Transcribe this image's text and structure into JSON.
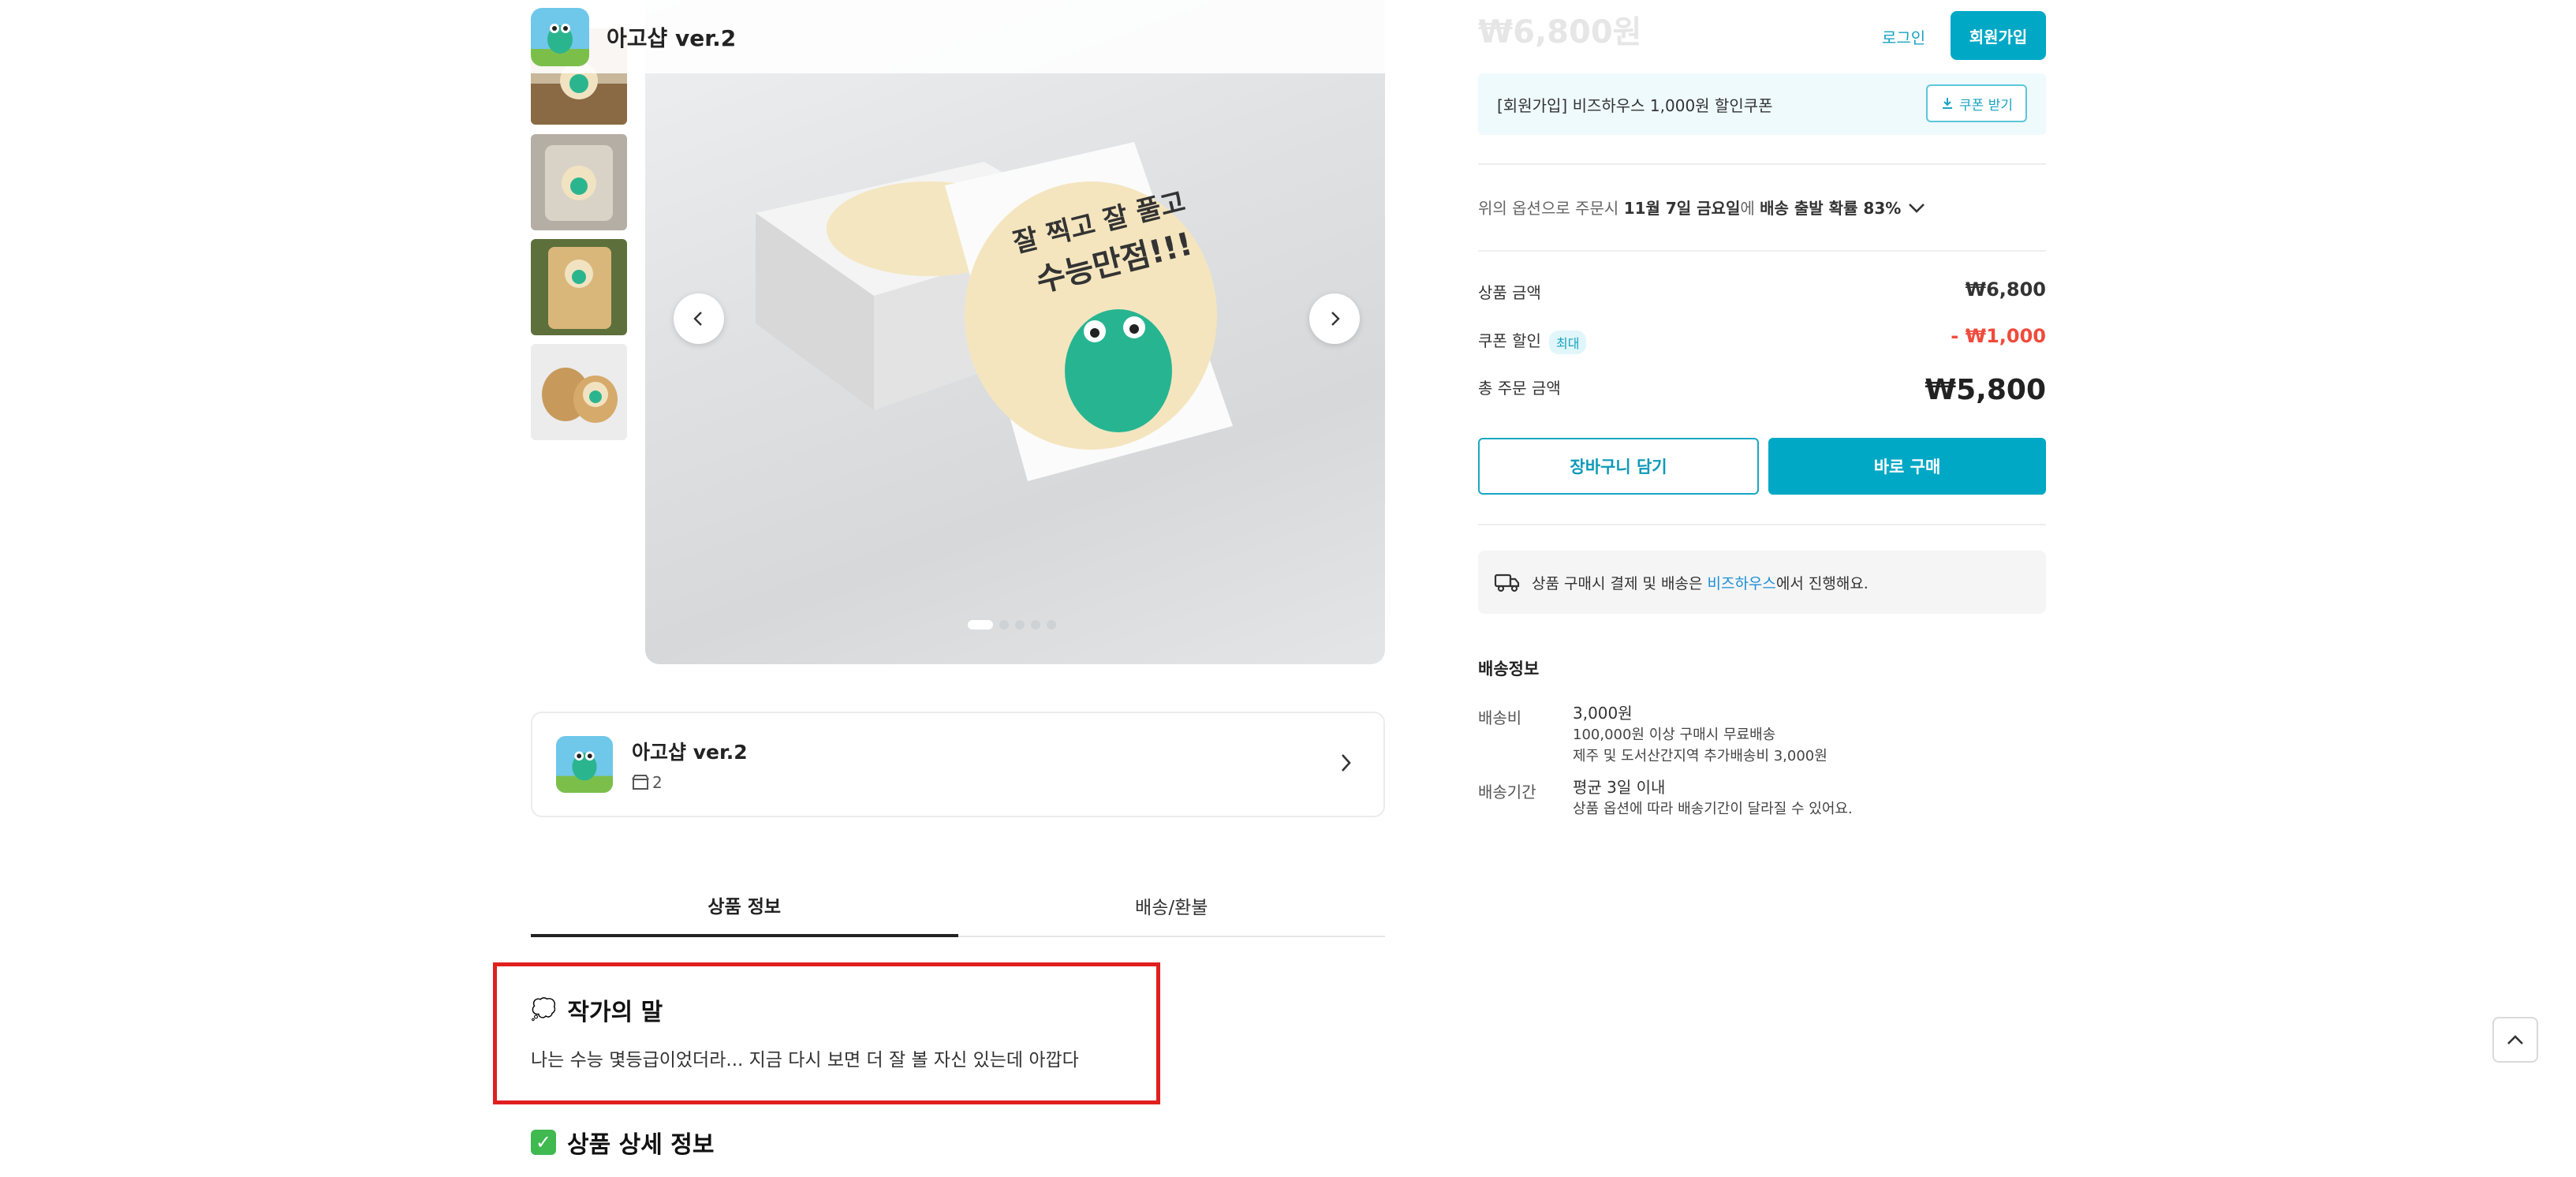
{
  "header": {
    "shop_name": "아고샵 ver.2"
  },
  "gallery": {
    "thumbnail_count": 5,
    "dot_count": 5,
    "active_dot": 1
  },
  "shop_card": {
    "name": "아고샵 ver.2",
    "product_count": "2"
  },
  "tabs": [
    {
      "label": "상품 정보",
      "active": true
    },
    {
      "label": "배송/환불",
      "active": false
    }
  ],
  "content": {
    "note_emoji": "💭",
    "note_title": "작가의 말",
    "note_text": "나는 수능 몇등급이었더라... 지금 다시 보면 더 잘 볼 자신 있는데 아깝다",
    "detail_check": "✓",
    "detail_title": "상품 상세 정보"
  },
  "purchase": {
    "price_faded": "₩6,800원",
    "login_label": "로그인",
    "signup_label": "회원가입",
    "coupon_text": "[회원가입] 비즈하우스 1,000원 할인쿠폰",
    "coupon_button": "쿠폰 받기",
    "ship_estimate_prefix": "위의 옵션으로 주문시 ",
    "ship_estimate_date": "11월 7일 금요일",
    "ship_estimate_mid": "에 ",
    "ship_estimate_prob": "배송 출발 확률 83%",
    "product_amount_label": "상품 금액",
    "product_amount_value": "₩6,800",
    "coupon_discount_label": "쿠폰 할인",
    "coupon_discount_badge": "최대",
    "coupon_discount_value": "- ₩1,000",
    "total_label": "총 주문 금액",
    "total_value": "₩5,800",
    "cart_button": "장바구니 담기",
    "buy_button": "바로 구매",
    "pay_notice_prefix": "상품 구매시 결제 및 배송은 ",
    "pay_notice_link": "비즈하우스",
    "pay_notice_suffix": "에서 진행해요."
  },
  "shipping": {
    "title": "배송정보",
    "fee_label": "배송비",
    "fee_value": "3,000원",
    "fee_note1": "100,000원 이상 구매시 무료배송",
    "fee_note2": "제주 및 도서산간지역 추가배송비 3,000원",
    "period_label": "배송기간",
    "period_value": "평균 3일 이내",
    "period_note": "상품 옵션에 따라 배송기간이 달라질 수 있어요."
  },
  "colors": {
    "accent": "#00a8c6",
    "discount": "#f04a3c",
    "highlight_box": "#e01f1f"
  },
  "icons": [
    "shop-logo-icon",
    "chevron-left-icon",
    "chevron-right-icon",
    "chevron-down-icon",
    "download-icon",
    "truck-icon",
    "store-icon",
    "scroll-top-icon",
    "check-icon",
    "thought-bubble-icon"
  ]
}
